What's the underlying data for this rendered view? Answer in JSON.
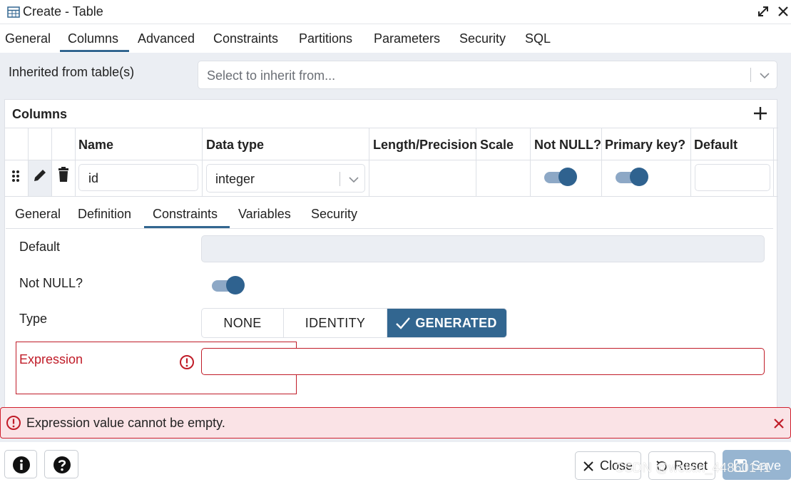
{
  "window": {
    "title": "Create - Table",
    "icons": {
      "title": "table-icon",
      "expand": "expand-icon",
      "close": "close-icon"
    }
  },
  "top_tabs": [
    "General",
    "Columns",
    "Advanced",
    "Constraints",
    "Partitions",
    "Parameters",
    "Security",
    "SQL"
  ],
  "top_tabs_active": "Columns",
  "inherit": {
    "label": "Inherited from table(s)",
    "placeholder": "Select to inherit from..."
  },
  "columns": {
    "title": "Columns",
    "headers": [
      "Name",
      "Data type",
      "Length/Precision",
      "Scale",
      "Not NULL?",
      "Primary key?",
      "Default"
    ],
    "row": {
      "name": "id",
      "data_type": "integer",
      "length": "",
      "scale": "",
      "not_null": true,
      "primary_key": true,
      "default": ""
    }
  },
  "inner_tabs": [
    "General",
    "Definition",
    "Constraints",
    "Variables",
    "Security"
  ],
  "inner_tabs_active": "Constraints",
  "form": {
    "default_label": "Default",
    "default_value": "",
    "not_null_label": "Not NULL?",
    "not_null": true,
    "type_label": "Type",
    "type_options": [
      "NONE",
      "IDENTITY",
      "GENERATED"
    ],
    "type_selected": "GENERATED",
    "expression_label": "Expression",
    "expression_value": ""
  },
  "alert": {
    "message": "Expression value cannot be empty."
  },
  "footer": {
    "close_label": "Close",
    "reset_label": "Reset",
    "save_label": "Save"
  },
  "watermark": "CSDN @weixin_44860141",
  "colors": {
    "accent": "#326690",
    "error": "#d0202e",
    "error_bg": "#fae3e6",
    "content_bg": "#ebeef3"
  }
}
